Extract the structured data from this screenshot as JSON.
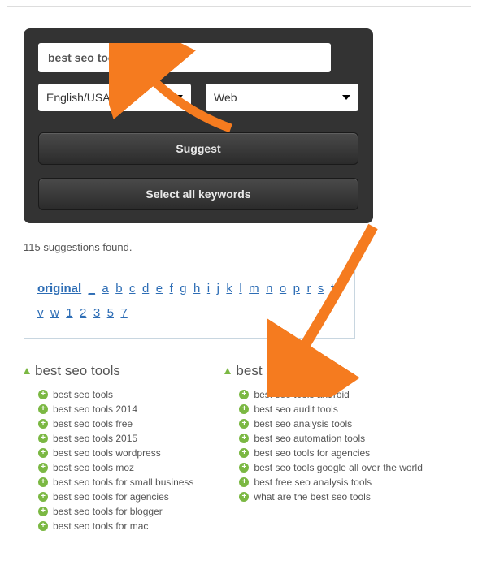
{
  "search": {
    "query": "best seo tools",
    "lang": "English/USA",
    "source": "Web",
    "suggest_label": "Suggest",
    "select_all_label": "Select all keywords"
  },
  "status": "115 suggestions found.",
  "nav": [
    "original",
    "_",
    "a",
    "b",
    "c",
    "d",
    "e",
    "f",
    "g",
    "h",
    "i",
    "j",
    "k",
    "l",
    "m",
    "n",
    "o",
    "p",
    "r",
    "s",
    "t",
    "v",
    "w",
    "1",
    "2",
    "3",
    "5",
    "7"
  ],
  "groups": [
    {
      "title": "best seo tools",
      "items": [
        "best seo tools",
        "best seo tools 2014",
        "best seo tools free",
        "best seo tools 2015",
        "best seo tools wordpress",
        "best seo tools moz",
        "best seo tools for small business",
        "best seo tools for agencies",
        "best seo tools for blogger",
        "best seo tools for mac"
      ]
    },
    {
      "title": "best seo tools + a",
      "items": [
        "best seo tools android",
        "best seo audit tools",
        "best seo analysis tools",
        "best seo automation tools",
        "best seo tools for agencies",
        "best seo tools google all over the world",
        "best free seo analysis tools",
        "what are the best seo tools"
      ]
    }
  ]
}
